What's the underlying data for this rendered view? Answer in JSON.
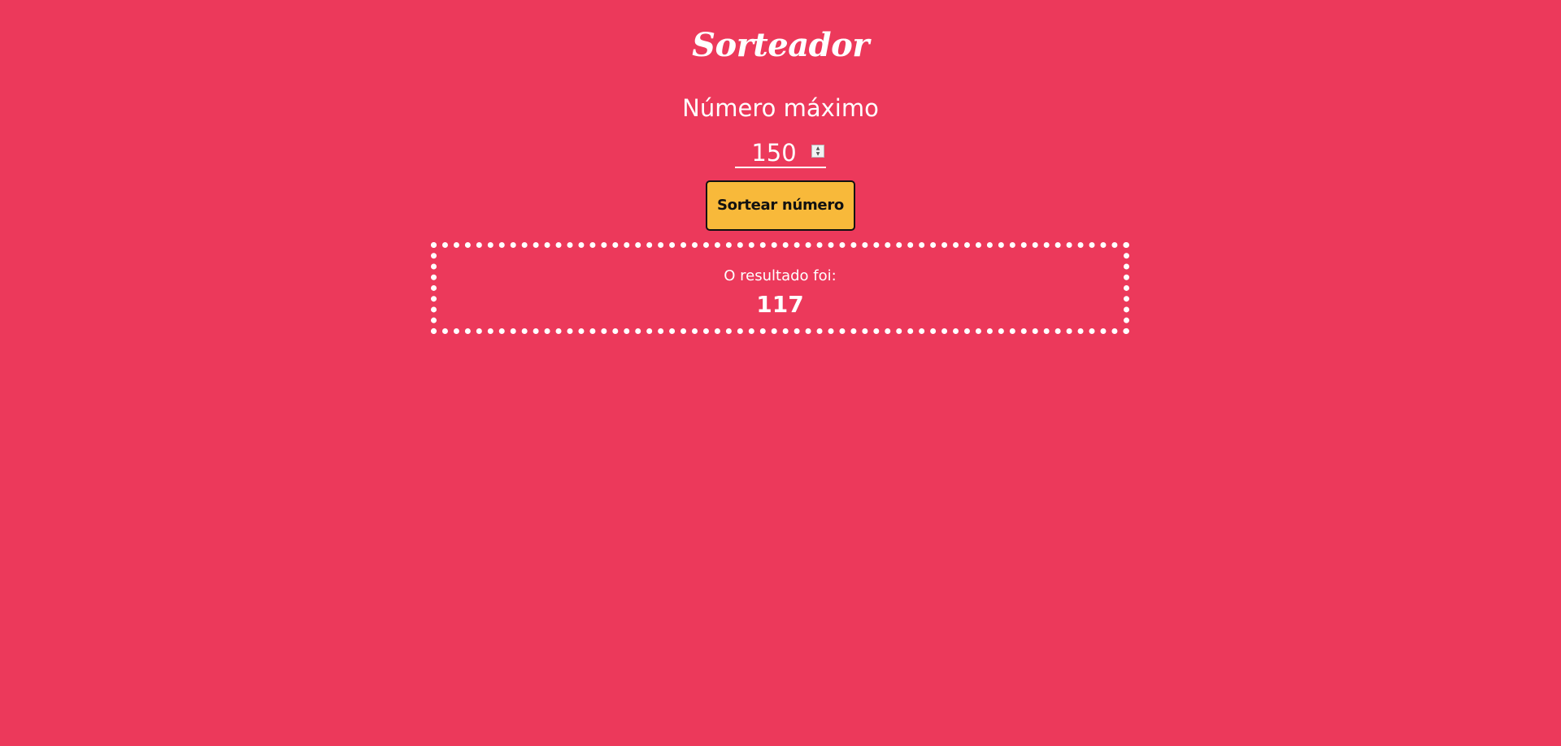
{
  "app": {
    "title": "Sorteador"
  },
  "form": {
    "max_label": "Número máximo",
    "max_value": "150",
    "button_label": "Sortear número"
  },
  "result": {
    "label": "O resultado foi:",
    "value": "117"
  },
  "colors": {
    "background": "#ec395b",
    "button": "#f8b93a",
    "text": "#ffffff"
  },
  "icons": {
    "spinner": "number-spinner-icon"
  }
}
